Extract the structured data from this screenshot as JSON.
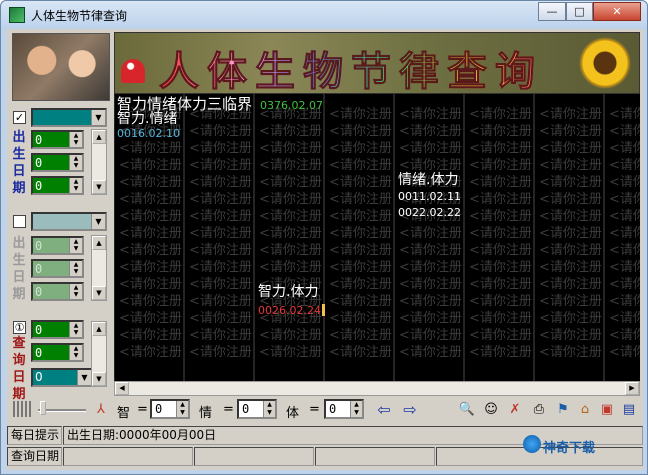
{
  "window": {
    "title": "人体生物节律查询",
    "minimize": "—",
    "maximize": "□",
    "close": "✕"
  },
  "left_panel": {
    "birth_label": [
      "出",
      "生",
      "日",
      "期"
    ],
    "birth2_label": [
      "出",
      "生",
      "日",
      "期"
    ],
    "query_label": [
      "查",
      "询",
      "日",
      "期"
    ],
    "birth_fields": [
      "0",
      "0",
      "0"
    ],
    "birth2_fields": [
      "0",
      "0",
      "0"
    ],
    "query_fields": [
      "0",
      "0",
      "0"
    ],
    "check1": "✓",
    "check3": "①"
  },
  "banner": {
    "title": "人体生物节律查询"
  },
  "chart": {
    "watermark": "请你注册",
    "labels": [
      {
        "text": "智力情绪体力三临界",
        "color": "#ffffff"
      },
      {
        "text": "0376.02.07",
        "color": "#3fbf3f"
      },
      {
        "text": "智力.情绪",
        "color": "#ffffff"
      },
      {
        "text": "0016.02.10",
        "color": "#4fb3d9"
      },
      {
        "text": "情绪.体力",
        "color": "#ffffff"
      },
      {
        "text": "0011.02.11",
        "color": "#ffffff"
      },
      {
        "text": "0022.02.22",
        "color": "#ffffff"
      },
      {
        "text": "智力.体力",
        "color": "#ffffff"
      },
      {
        "text": "0026.02.24",
        "color": "#e63a3a"
      }
    ]
  },
  "toolbar": {
    "zhi_label": "智",
    "qing_label": "情",
    "ti_label": "体",
    "eq": "=",
    "zhi_value": "0",
    "qing_value": "0",
    "ti_value": "0",
    "left_arrow": "⇦",
    "right_arrow": "⇨"
  },
  "status": {
    "daily_tip": "每日提示",
    "birth_date_text": "出生日期:0000年00月00日",
    "query_date": "查询日期",
    "logo": "神奇下载"
  }
}
